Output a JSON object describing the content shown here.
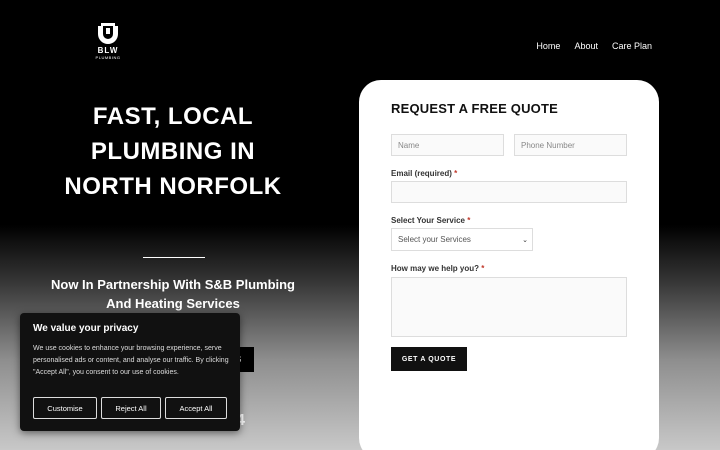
{
  "logo": {
    "brand": "BLW",
    "sub": "PLUMBING"
  },
  "nav": {
    "items": [
      "Home",
      "About",
      "Care Plan"
    ]
  },
  "hero": {
    "title": "FAST, LOCAL PLUMBING IN NORTH NORFOLK",
    "subtitle": "Now In Partnership With S&B Plumbing And Heating Services",
    "button_fragment": "S",
    "phone_fragment": "4"
  },
  "form": {
    "title": "REQUEST A FREE QUOTE",
    "name_placeholder": "Name",
    "phone_placeholder": "Phone Number",
    "email_label": "Email (required)",
    "service_label": "Select Your Service",
    "service_selected": "Select your Services",
    "help_label": "How may we help you?",
    "required_mark": "*",
    "submit_label": "GET A QUOTE"
  },
  "cookie": {
    "title": "We value your privacy",
    "text": "We use cookies to enhance your browsing experience, serve personalised ads or content, and analyse our traffic. By clicking \"Accept All\", you consent to our use of cookies.",
    "customise": "Customise",
    "reject": "Reject All",
    "accept": "Accept All"
  }
}
